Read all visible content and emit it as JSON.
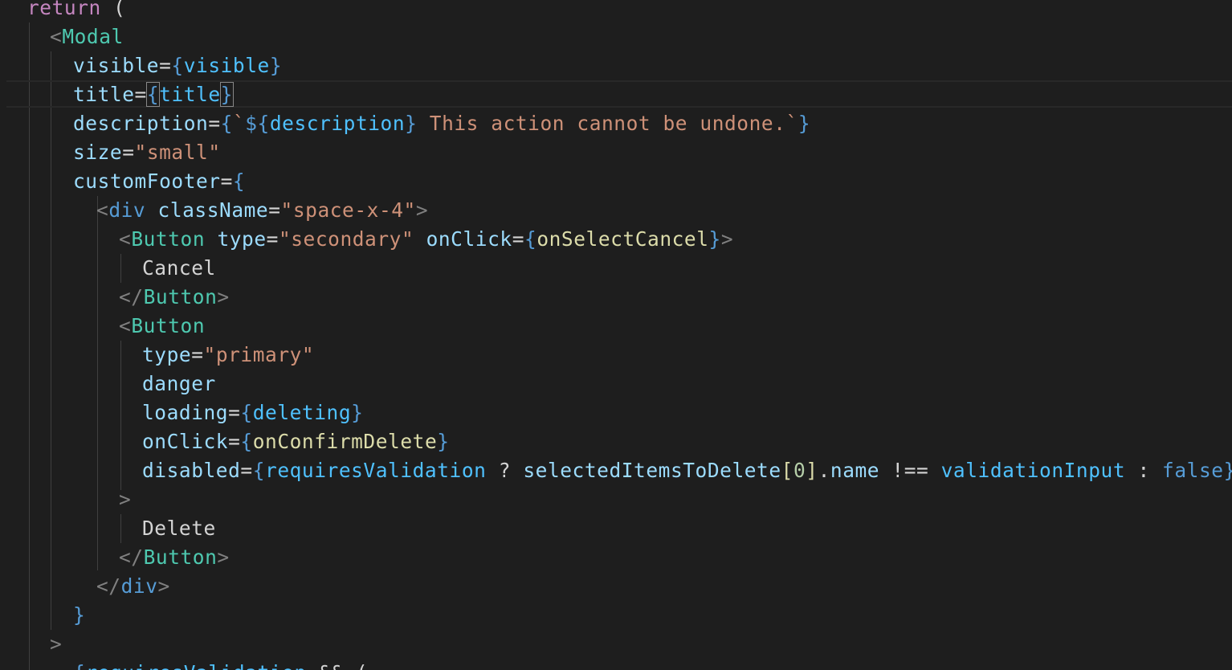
{
  "code": {
    "l0": {
      "kw": "return",
      "p": " ("
    },
    "l1": {
      "lt": "<",
      "tag": "Modal"
    },
    "l2": {
      "attr": "visible",
      "eq": "=",
      "ob": "{",
      "var": "visible",
      "cb": "}"
    },
    "l3": {
      "attr": "title",
      "eq": "=",
      "ob": "{",
      "var": "title",
      "cb": "}"
    },
    "l4": {
      "attr": "description",
      "eq": "=",
      "ob": "{",
      "bt": "`",
      "dl": "${",
      "var": "description",
      "dr": "}",
      "str": " This action cannot be undone.",
      "bt2": "`",
      "cb": "}"
    },
    "l5": {
      "attr": "size",
      "eq": "=",
      "str": "\"small\""
    },
    "l6": {
      "attr": "customFooter",
      "eq": "=",
      "ob": "{"
    },
    "l7": {
      "lt": "<",
      "tag": "div",
      "attr": "className",
      "eq": "=",
      "str": "\"space-x-4\"",
      "gt": ">"
    },
    "l8": {
      "lt": "<",
      "tag": "Button",
      "attr": "type",
      "eq": "=",
      "str": "\"secondary\"",
      "attr2": "onClick",
      "eq2": "=",
      "ob": "{",
      "fn": "onSelectCancel",
      "cb": "}",
      "gt": ">"
    },
    "l9": {
      "text": "Cancel"
    },
    "l10": {
      "lt": "</",
      "tag": "Button",
      "gt": ">"
    },
    "l11": {
      "lt": "<",
      "tag": "Button"
    },
    "l12": {
      "attr": "type",
      "eq": "=",
      "str": "\"primary\""
    },
    "l13": {
      "attr": "danger"
    },
    "l14": {
      "attr": "loading",
      "eq": "=",
      "ob": "{",
      "var": "deleting",
      "cb": "}"
    },
    "l15": {
      "attr": "onClick",
      "eq": "=",
      "ob": "{",
      "fn": "onConfirmDelete",
      "cb": "}"
    },
    "l16": {
      "attr": "disabled",
      "eq": "=",
      "ob": "{",
      "var": "requiresValidation",
      "q": " ? ",
      "var2": "selectedItemsToDelete",
      "lb": "[",
      "num": "0",
      "rb": "]",
      "dot": ".",
      "prop": "name",
      "op": " !== ",
      "var3": "validationInput",
      "colon": " : ",
      "bool": "false",
      "cb": "}"
    },
    "l17": {
      "gt": ">"
    },
    "l18": {
      "text": "Delete"
    },
    "l19": {
      "lt": "</",
      "tag": "Button",
      "gt": ">"
    },
    "l20": {
      "lt": "</",
      "tag": "div",
      "gt": ">"
    },
    "l21": {
      "cb": "}"
    },
    "l22": {
      "gt": ">"
    },
    "l23": {
      "ob": "{",
      "var": "requiresValidation",
      "op": " && ("
    }
  }
}
